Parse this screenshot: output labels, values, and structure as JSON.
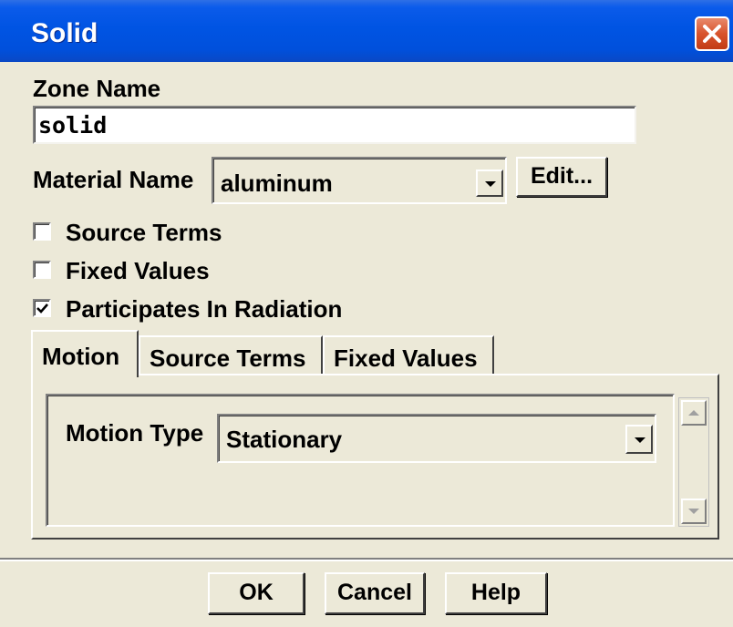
{
  "window": {
    "title": "Solid"
  },
  "zone": {
    "label": "Zone Name",
    "value": "solid"
  },
  "material": {
    "label": "Material Name",
    "value": "aluminum",
    "edit_label": "Edit..."
  },
  "options": {
    "source_terms": {
      "label": "Source Terms",
      "checked": false
    },
    "fixed_values": {
      "label": "Fixed Values",
      "checked": false
    },
    "participates_radiation": {
      "label": "Participates In Radiation",
      "checked": true
    }
  },
  "tabs": [
    {
      "label": "Motion",
      "active": true
    },
    {
      "label": "Source Terms",
      "active": false
    },
    {
      "label": "Fixed Values",
      "active": false
    }
  ],
  "motion": {
    "label": "Motion Type",
    "value": "Stationary"
  },
  "buttons": {
    "ok": "OK",
    "cancel": "Cancel",
    "help": "Help"
  },
  "colors": {
    "titlebar": "#0054e3",
    "dialog_bg": "#ece9d8",
    "close_button": "#d8532c"
  }
}
